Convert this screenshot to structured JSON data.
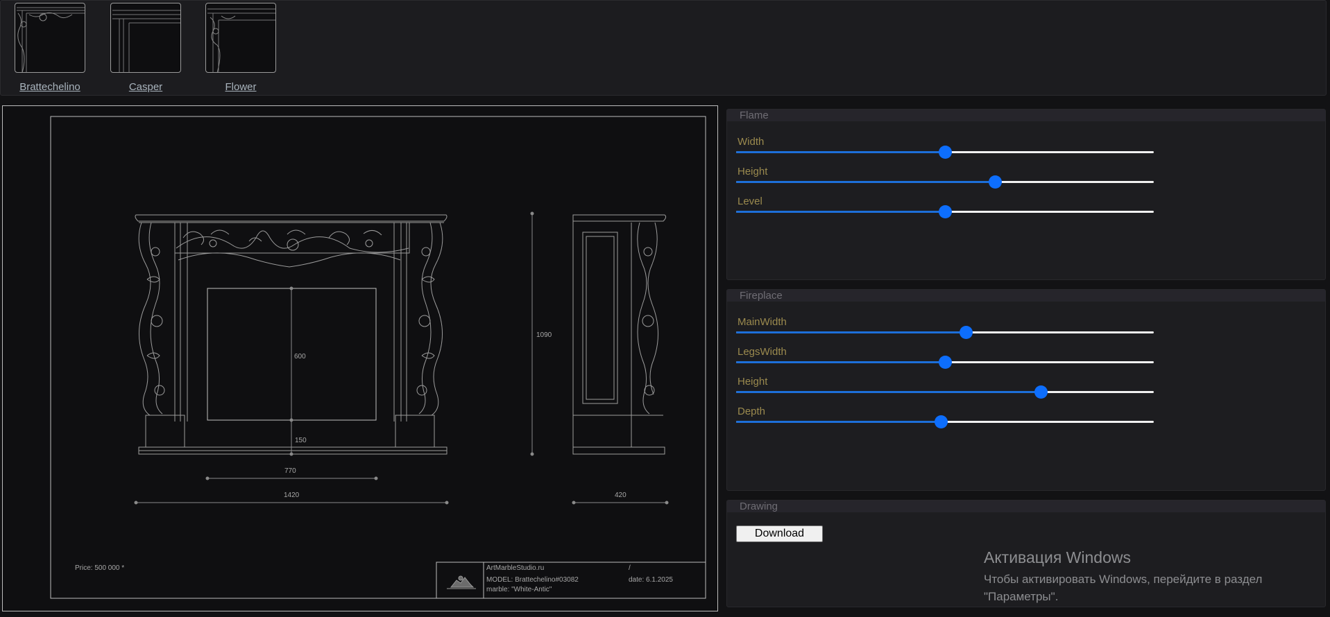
{
  "models": [
    {
      "label": "Brattechelino"
    },
    {
      "label": "Casper"
    },
    {
      "label": "Flower"
    }
  ],
  "drawing": {
    "dimensions": {
      "firebox_height": "600",
      "plinth": "150",
      "firebox_width": "770",
      "overall_width": "1420",
      "overall_height": "1090",
      "depth": "420"
    },
    "price": "Price: 500 000 *",
    "title_block": {
      "studio": "ArtMarbleStudio.ru",
      "model": "MODEL: Brattechelino#03082",
      "marble": "marble: \"White-Antic\"",
      "sheet": "/",
      "date": "date: 6.1.2025"
    }
  },
  "flame": {
    "title": "Flame",
    "sliders": [
      {
        "label": "Width",
        "value": 0.5
      },
      {
        "label": "Height",
        "value": 0.62
      },
      {
        "label": "Level",
        "value": 0.5
      }
    ]
  },
  "fireplace": {
    "title": "Fireplace",
    "sliders": [
      {
        "label": "MainWidth",
        "value": 0.55
      },
      {
        "label": "LegsWidth",
        "value": 0.5
      },
      {
        "label": "Height",
        "value": 0.73
      },
      {
        "label": "Depth",
        "value": 0.49
      }
    ]
  },
  "drawing_panel": {
    "title": "Drawing",
    "download_label": "Download"
  },
  "windows_activation": {
    "title": "Активация Windows",
    "text": "Чтобы активировать Windows, перейдите в раздел \"Параметры\"."
  },
  "colors": {
    "accent": "#0d6efd",
    "label": "#9b8a4e",
    "line": "#bdbdbd"
  }
}
